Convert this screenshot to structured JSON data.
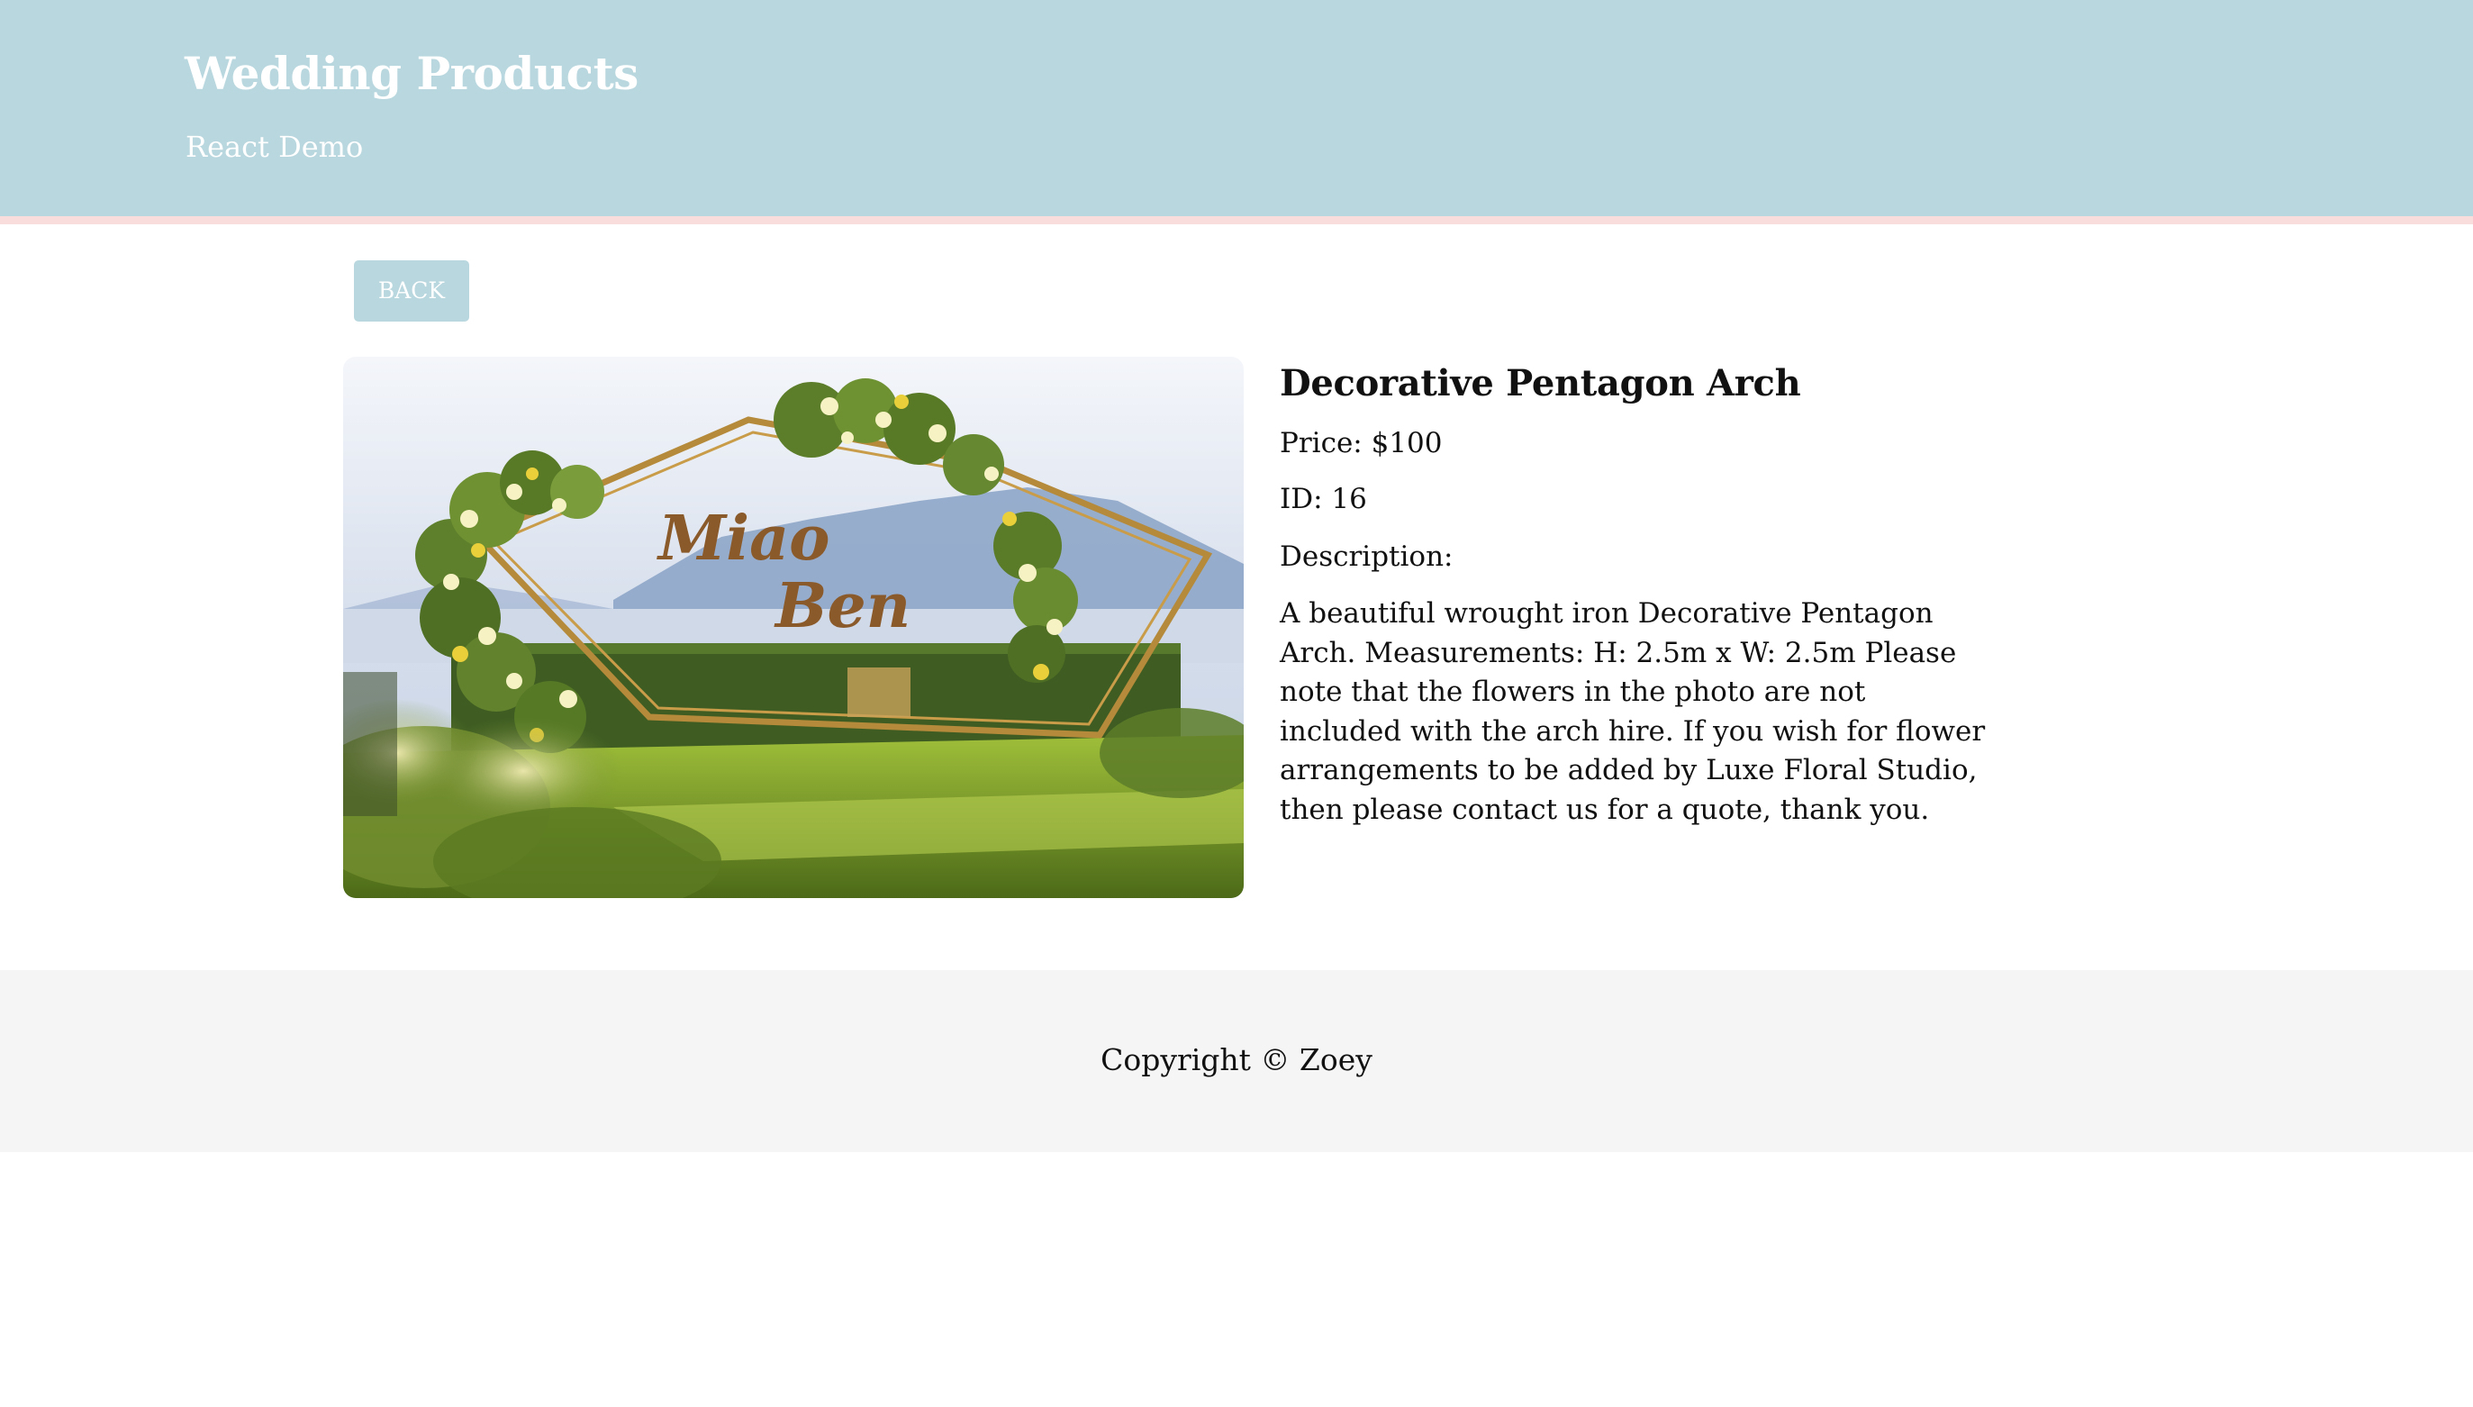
{
  "header": {
    "title": "Wedding Products",
    "subtitle": "React Demo"
  },
  "back_button": {
    "label": "BACK"
  },
  "product": {
    "image_alt": "Decorative Pentagon Arch",
    "image_sign_text": [
      "Miao",
      "Ben"
    ],
    "name": "Decorative Pentagon Arch",
    "price": "Price: $100",
    "id": "ID: 16",
    "description_label": "Description:",
    "description": "A beautiful wrought iron Decorative Pentagon Arch. Measurements: H: 2.5m x W: 2.5m Please note that the flowers in the photo are not included with the arch hire. If you wish for flower arrangements to be added by Luxe Floral Studio, then please contact us for a quote, thank you."
  },
  "footer": {
    "copyright": "Copyright © Zoey"
  },
  "colors": {
    "header_bg": "#b9d7de",
    "header_stripe": "#f9dcdc",
    "footer_bg": "#f5f5f5",
    "text": "#111111"
  }
}
